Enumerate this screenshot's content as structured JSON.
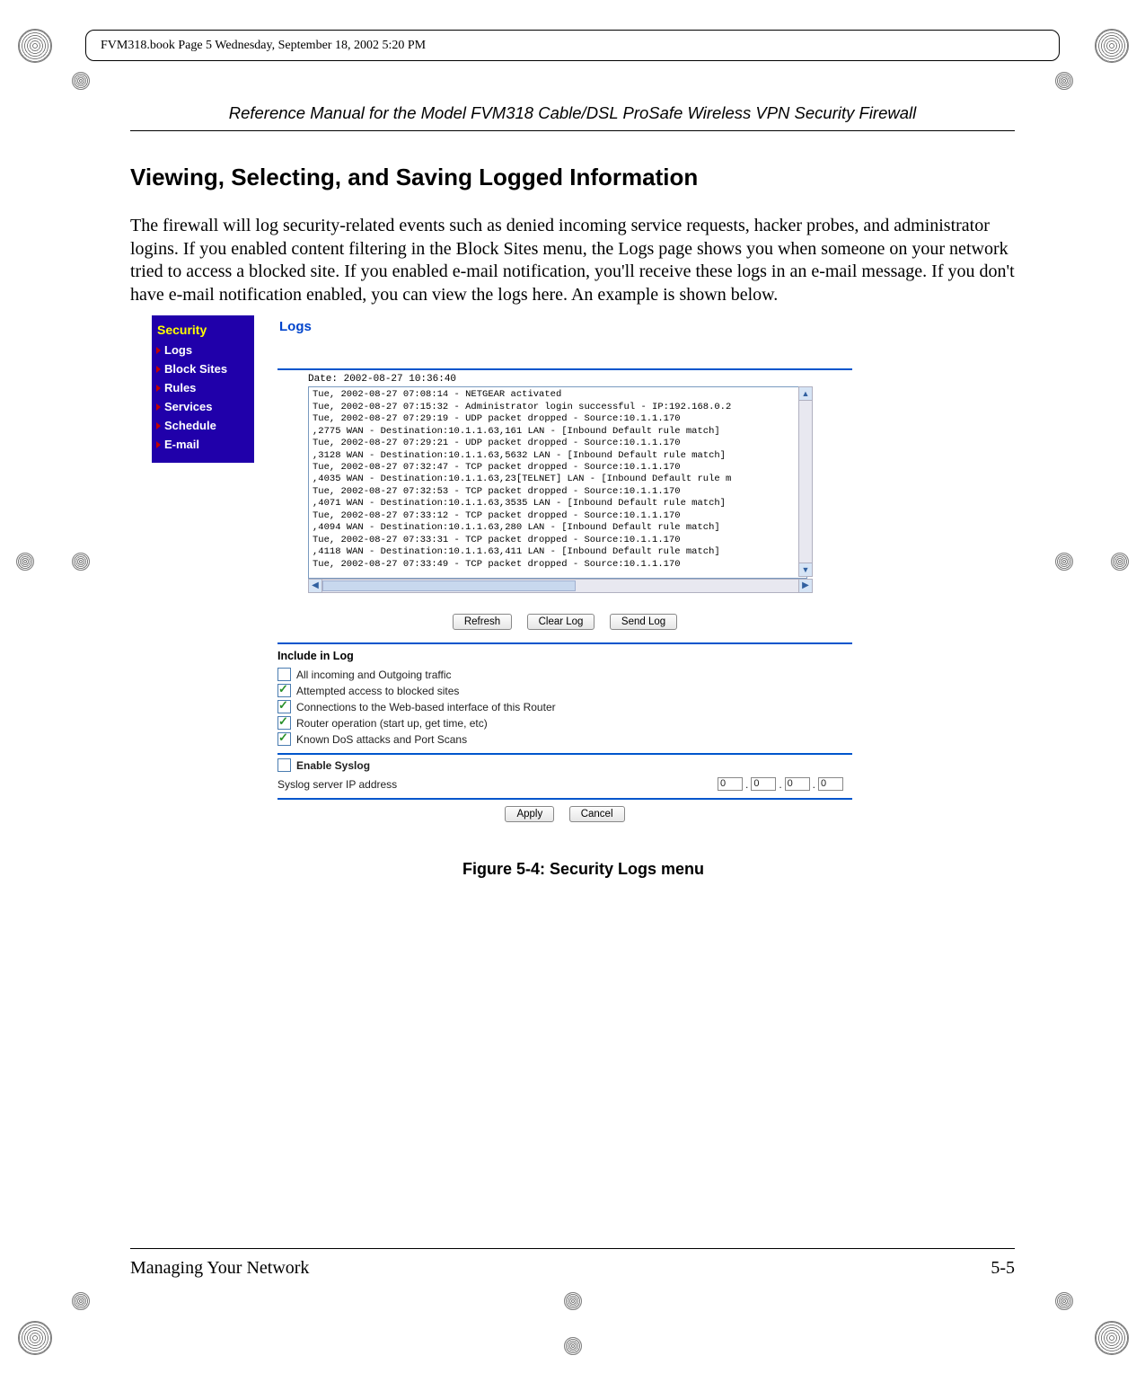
{
  "printmeta": "FVM318.book  Page 5  Wednesday, September 18, 2002  5:20 PM",
  "running_header": "Reference Manual for the Model FVM318 Cable/DSL ProSafe Wireless VPN Security Firewall",
  "section_heading": "Viewing, Selecting, and Saving Logged Information",
  "body": "The firewall will log security-related events such as denied incoming service requests, hacker probes, and administrator logins. If you enabled content filtering in the Block Sites menu, the Logs page shows you when someone on your network tried to access a blocked site. If you enabled e-mail notification, you'll receive these logs in an e-mail message. If you don't have e-mail notification enabled, you can view the logs here. An example is shown below.",
  "sidebar": {
    "heading": "Security",
    "items": [
      "Logs",
      "Block Sites",
      "Rules",
      "Services",
      "Schedule",
      "E-mail"
    ]
  },
  "logs_panel": {
    "title": "Logs",
    "date_label": "Date: 2002-08-27 10:36:40",
    "entries": [
      "Tue, 2002-08-27 07:08:14 - NETGEAR activated",
      "Tue, 2002-08-27 07:15:32 - Administrator login successful - IP:192.168.0.2",
      "Tue, 2002-08-27 07:29:19 - UDP packet dropped - Source:10.1.1.170",
      ",2775 WAN - Destination:10.1.1.63,161 LAN - [Inbound Default rule match]",
      "Tue, 2002-08-27 07:29:21 - UDP packet dropped - Source:10.1.1.170",
      ",3128 WAN - Destination:10.1.1.63,5632 LAN - [Inbound Default rule match]",
      "Tue, 2002-08-27 07:32:47 - TCP packet dropped - Source:10.1.1.170",
      ",4035 WAN - Destination:10.1.1.63,23[TELNET] LAN - [Inbound Default rule m",
      "Tue, 2002-08-27 07:32:53 - TCP packet dropped - Source:10.1.1.170",
      ",4071 WAN - Destination:10.1.1.63,3535 LAN - [Inbound Default rule match]",
      "Tue, 2002-08-27 07:33:12 - TCP packet dropped - Source:10.1.1.170",
      ",4094 WAN - Destination:10.1.1.63,280 LAN - [Inbound Default rule match]",
      "Tue, 2002-08-27 07:33:31 - TCP packet dropped - Source:10.1.1.170",
      ",4118 WAN - Destination:10.1.1.63,411 LAN - [Inbound Default rule match]",
      "Tue, 2002-08-27 07:33:49 - TCP packet dropped - Source:10.1.1.170"
    ],
    "buttons": {
      "refresh": "Refresh",
      "clear": "Clear Log",
      "send": "Send Log"
    },
    "include_heading": "Include in Log",
    "include_items": [
      {
        "label": "All incoming and Outgoing traffic",
        "checked": false
      },
      {
        "label": "Attempted access to blocked sites",
        "checked": true
      },
      {
        "label": "Connections to the Web-based interface of this Router",
        "checked": true
      },
      {
        "label": "Router operation (start up, get time, etc)",
        "checked": true
      },
      {
        "label": "Known DoS attacks and Port Scans",
        "checked": true
      }
    ],
    "syslog": {
      "enable_label": "Enable Syslog",
      "enable_checked": false,
      "address_label": "Syslog server IP address",
      "ip": [
        "0",
        "0",
        "0",
        "0"
      ]
    },
    "footer_buttons": {
      "apply": "Apply",
      "cancel": "Cancel"
    }
  },
  "figure_caption": "Figure 5-4: Security Logs menu",
  "footer": {
    "left": "Managing Your Network",
    "right": "5-5"
  }
}
